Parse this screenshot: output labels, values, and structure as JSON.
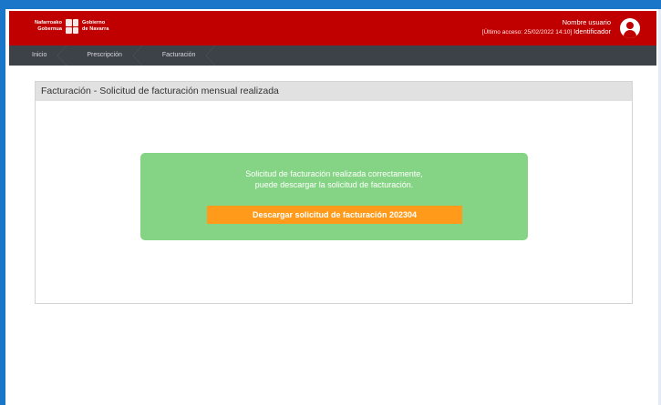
{
  "brand": {
    "line1_left": "Nafarroako",
    "line2_left": "Gobernua",
    "line1_right": "Gobierno",
    "line2_right": "de Navarra",
    "crest_icon": "navarra-crest-icon"
  },
  "user": {
    "name": "Nombre usuario",
    "last_access": "[Último acceso: 25/02/2022 14:10]",
    "identifier": "Identificador",
    "avatar_icon": "user-avatar-icon"
  },
  "nav": {
    "items": [
      {
        "label": "Inicio"
      },
      {
        "label": "Prescripción"
      },
      {
        "label": "Facturación"
      }
    ]
  },
  "panel": {
    "title": "Facturación - Solicitud de facturación mensual realizada"
  },
  "message": {
    "line1": "Solicitud de facturación realizada correctamente,",
    "line2": "puede descargar la solicitud de facturación.",
    "button_label": "Descargar solicitud de facturación 202304"
  },
  "colors": {
    "header": "#c00000",
    "navbar": "#3d4148",
    "success": "#85d485",
    "button": "#ff9a1a",
    "frame": "#1976c8"
  }
}
